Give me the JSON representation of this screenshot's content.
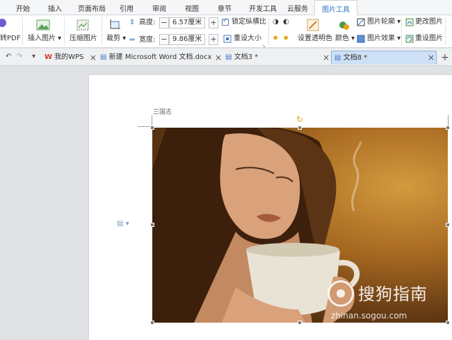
{
  "ribbon_tabs": [
    "开始",
    "插入",
    "页面布局",
    "引用",
    "审阅",
    "视图",
    "章节",
    "开发工具",
    "云服务",
    "图片工具"
  ],
  "ribbon": {
    "pdf_label": "转PDF",
    "insert_picture": "插入图片",
    "compress_picture": "压缩图片",
    "crop": "裁剪",
    "height_label": "高度:",
    "height_value": "6.57厘米",
    "width_label": "宽度:",
    "width_value": "9.86厘米",
    "lock_ratio": "锁定纵横比",
    "reset_size": "重设大小",
    "set_transparent": "设置透明色",
    "color": "颜色",
    "picture_outline": "图片轮廓",
    "picture_effects": "图片效果",
    "change_picture": "更改图片",
    "reset_picture": "重设图片"
  },
  "doc_tabs": {
    "wps_home": "我的WPS",
    "doc1": "新建 Microsoft Word 文档.docx",
    "doc2": "文档3 *",
    "doc3": "文档8 *",
    "add": "+"
  },
  "document": {
    "header_text": "三国志"
  },
  "watermark": {
    "title": "搜狗指南",
    "url": "zhinan.sogou.com"
  },
  "colors": {
    "accent": "#2b73c9",
    "tab_active_bg": "#cde0f5"
  }
}
